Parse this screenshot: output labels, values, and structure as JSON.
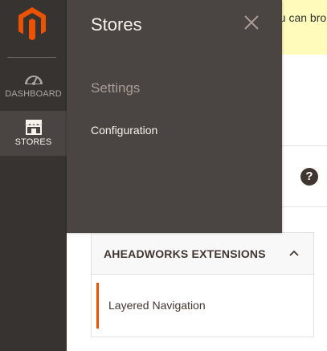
{
  "notice": {
    "text": "ou can bro"
  },
  "sidebar": {
    "items": [
      {
        "label": "DASHBOARD",
        "icon": "dashboard-gauge-icon"
      },
      {
        "label": "STORES",
        "icon": "storefront-icon"
      }
    ]
  },
  "flyout": {
    "title": "Stores",
    "section_title": "Settings",
    "links": [
      {
        "label": "Configuration"
      }
    ]
  },
  "help": {
    "label": "?"
  },
  "config_panel": {
    "header": "AHEADWORKS EXTENSIONS",
    "items": [
      {
        "label": "Layered Navigation",
        "active": true
      }
    ]
  },
  "colors": {
    "menu_bg": "#373330",
    "menu_active_bg": "#4a4542",
    "flyout_bg": "#4a4542",
    "accent": "#eb5202",
    "notice_bg": "#fffbbb",
    "text_light": "#f7f3eb"
  }
}
